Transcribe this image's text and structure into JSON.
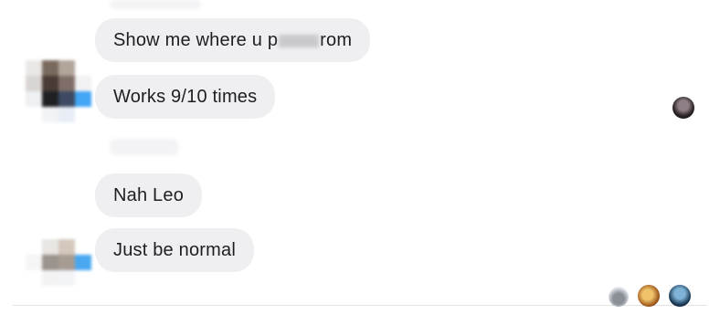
{
  "conversation": {
    "group1": {
      "messages": [
        {
          "prefix": "Show me where u p",
          "suffix": "rom"
        },
        {
          "text": "Works 9/10 times"
        }
      ]
    },
    "group2": {
      "messages": [
        {
          "text": "Nah Leo"
        },
        {
          "text": "Just be normal"
        }
      ]
    }
  },
  "colors": {
    "bubble_bg": "#efeff1",
    "text": "#1c1e21",
    "page_bg": "#ffffff"
  },
  "icons": {
    "avatar_top": "pixelated-avatar",
    "avatar_bottom": "pixelated-avatar",
    "seen_single": "read-receipt-avatar",
    "seen_group": "read-receipt-avatars"
  }
}
